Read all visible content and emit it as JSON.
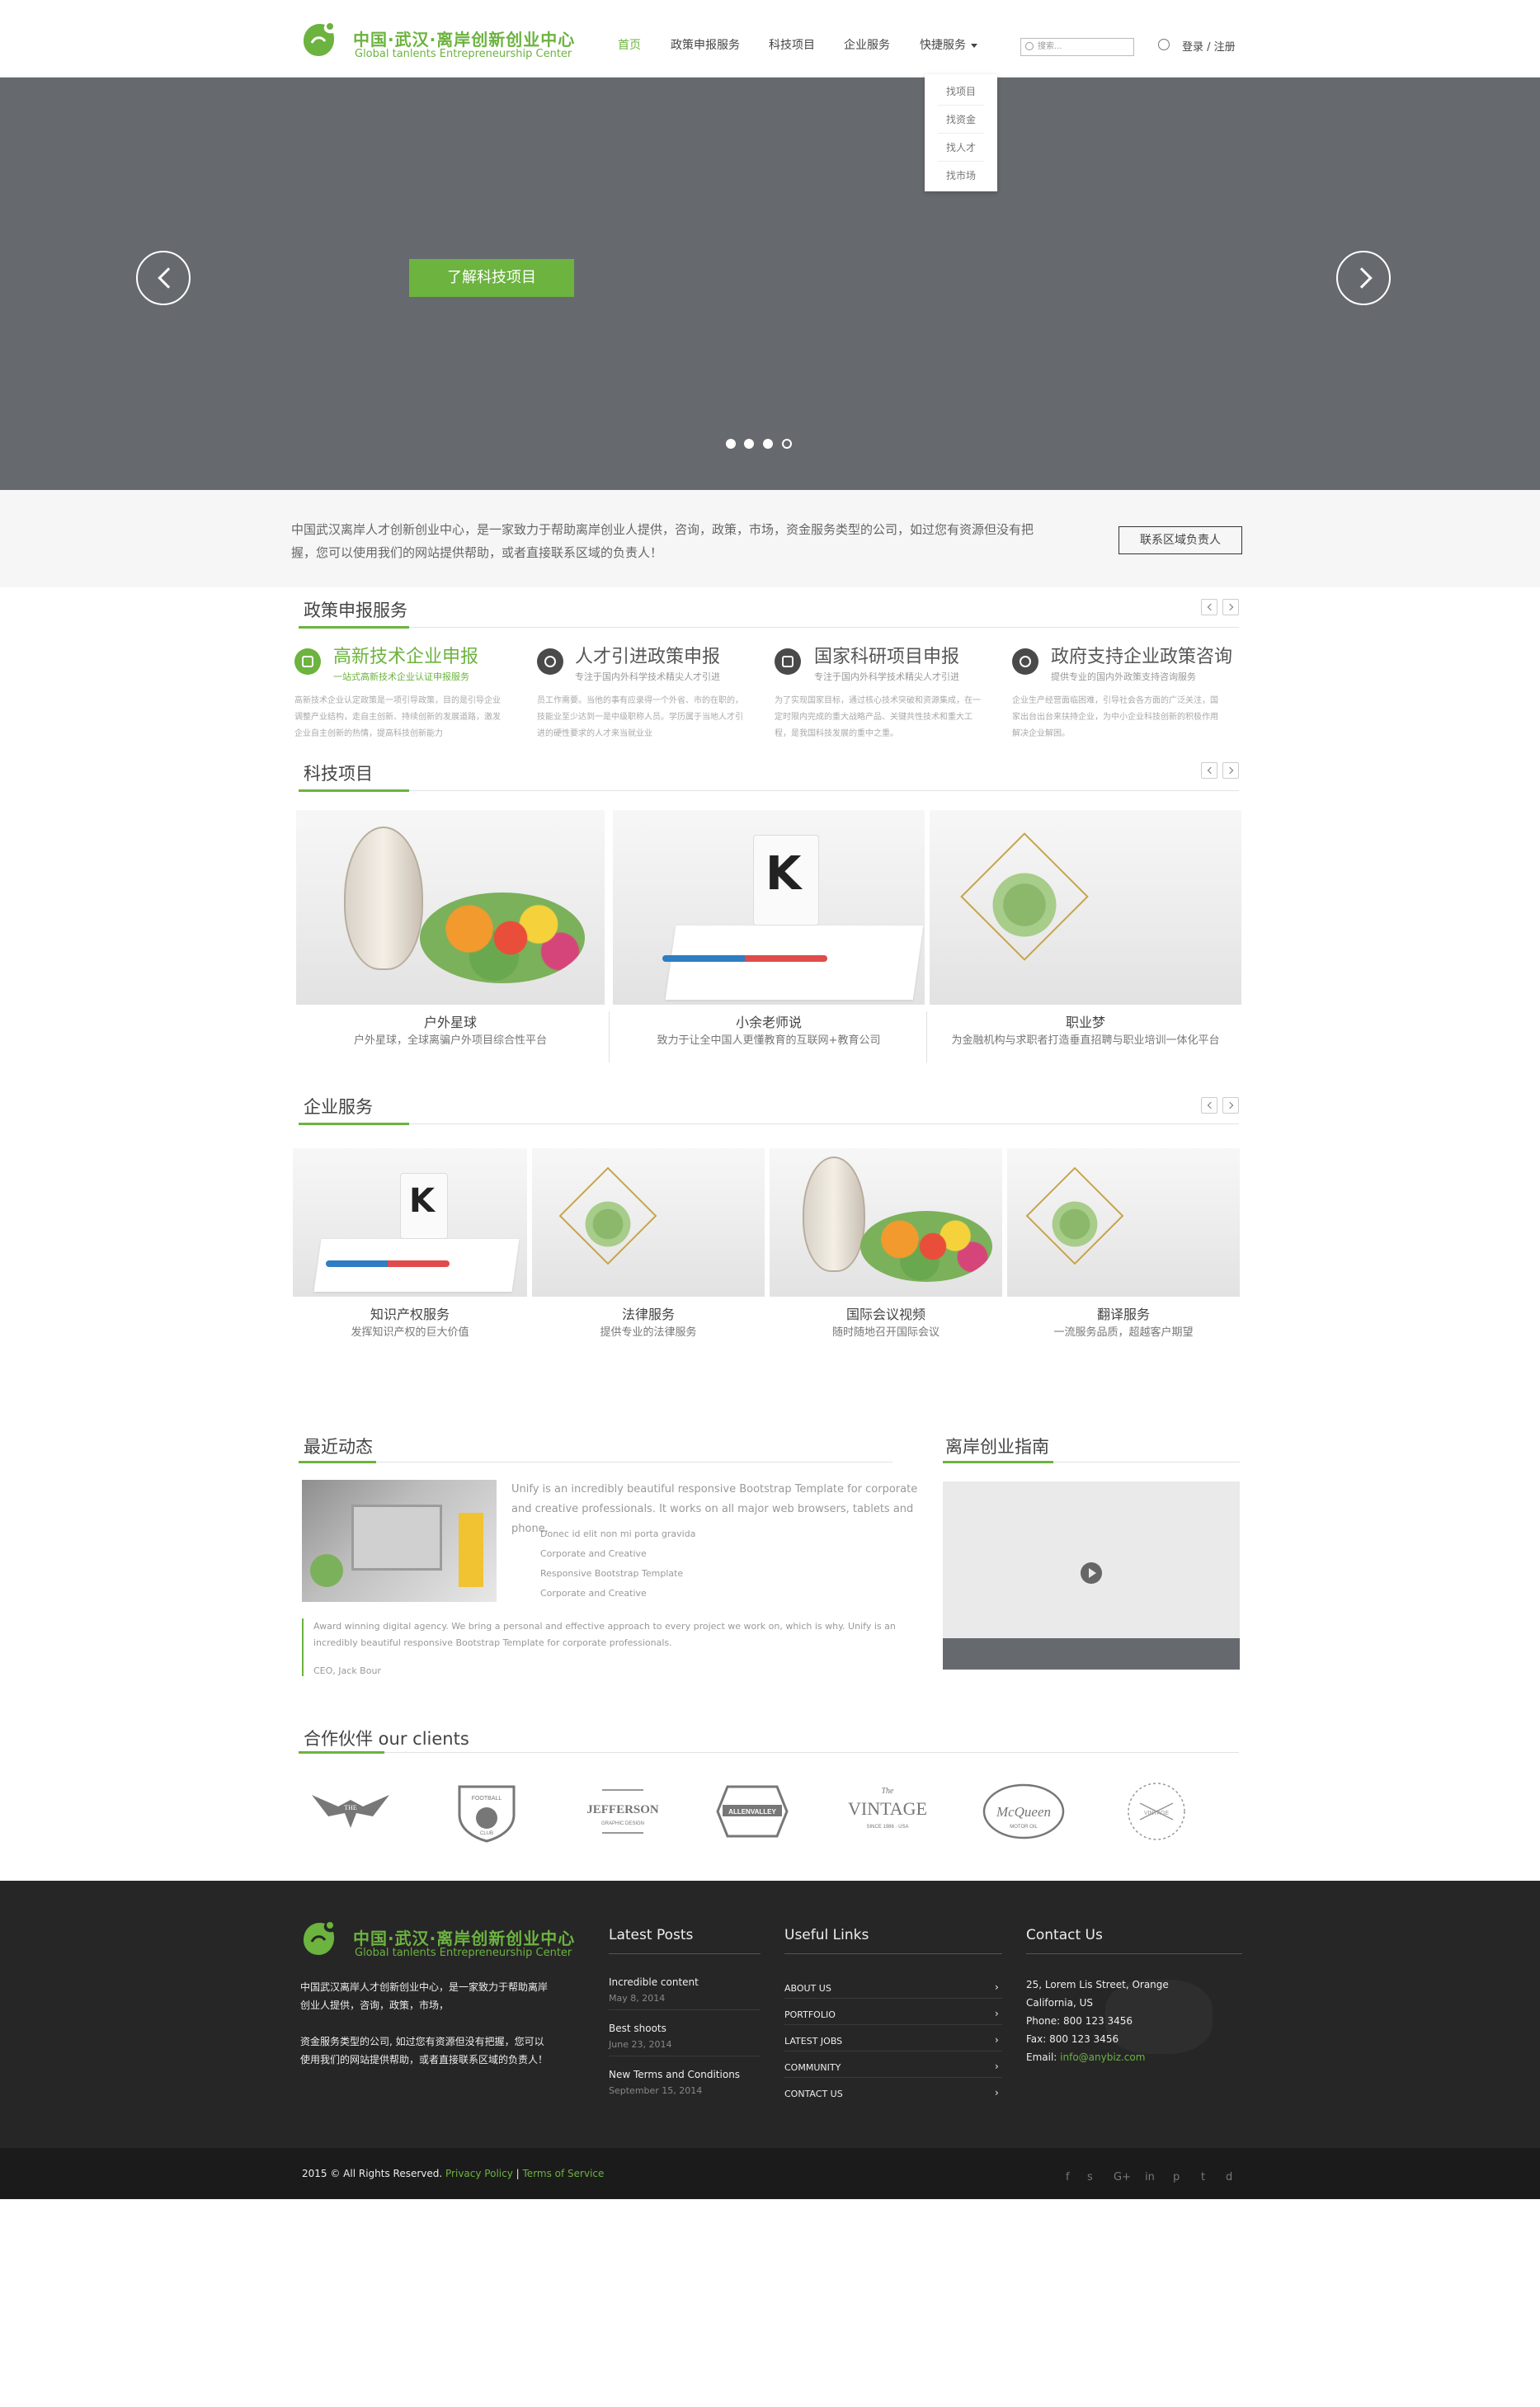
{
  "brand": {
    "name_cn": "中国·武汉·离岸创新创业中心",
    "name_en": "Global tanlents Entrepreneurship Center"
  },
  "nav": {
    "items": [
      "首页",
      "政策申报服务",
      "科技项目",
      "企业服务",
      "快捷服务"
    ],
    "active": "首页"
  },
  "search": {
    "placeholder": "搜索..."
  },
  "auth": {
    "label": "登录 / 注册"
  },
  "quick_menu": {
    "items": [
      "找项目",
      "找资金",
      "找人才",
      "找市场"
    ]
  },
  "hero": {
    "button": "了解科技项目",
    "slides": 4,
    "active_slide": 3
  },
  "intro": {
    "text": "中国武汉离岸人才创新创业中心，是一家致力于帮助离岸创业人提供，咨询，政策，市场，资金服务类型的公司，如过您有资源但没有把握，您可以使用我们的网站提供帮助，或者直接联系区域的负责人！",
    "button": "联系区域负责人"
  },
  "policy": {
    "title": "政策申报服务",
    "items": [
      {
        "title": "高新技术企业申报",
        "sub": "一站式高新技术企业认证申报服务",
        "body": "高新技术企业认定政策是一项引导政策，目的是引导企业调整产业结构，走自主创新、持续创新的发展道路，激发企业自主创新的热情，提高科技创新能力"
      },
      {
        "title": "人才引进政策申报",
        "sub": "专注于国内外科学技术精尖人才引进",
        "body": "员工作需要。当他的事有应录得一个外省、市的在职的，技能业至少达到一是中级职称人员。学历属于当地人才引进的硬性要求的人才来当就业业"
      },
      {
        "title": "国家科研项目申报",
        "sub": "专注于国内外科学技术精尖人才引进",
        "body": "为了实现国家目标，通过核心技术突破和资源集成，在一定时限内完成的重大战略产品、关键共性技术和重大工程，是我国科技发展的重中之重。"
      },
      {
        "title": "政府支持企业政策咨询",
        "sub": "提供专业的国内外政策支持咨询服务",
        "body": "企业生产经营面临困难，引导社会各方面的广泛关注，国家出台出台来扶持企业，为中小企业科技创新的积极作用解决企业解困。"
      }
    ]
  },
  "tech": {
    "title": "科技项目",
    "items": [
      {
        "title": "户外星球",
        "sub": "户外星球，全球离骗户外项目综合性平台"
      },
      {
        "title": "小余老师说",
        "sub": "致力于让全中国人更懂教育的互联网+教育公司"
      },
      {
        "title": "职业梦",
        "sub": "为金融机构与求职者打造垂直招聘与职业培训一体化平台"
      }
    ]
  },
  "enterprise": {
    "title": "企业服务",
    "items": [
      {
        "title": "知识产权服务",
        "sub": "发挥知识产权的巨大价值"
      },
      {
        "title": "法律服务",
        "sub": "提供专业的法律服务"
      },
      {
        "title": "国际会议视频",
        "sub": "随时随地召开国际会议"
      },
      {
        "title": "翻译服务",
        "sub": "一流服务品质，超越客户期望"
      }
    ]
  },
  "news": {
    "title": "最近动态",
    "text": "Unify is an incredibly beautiful responsive Bootstrap Template for corporate and creative professionals. It works on all major web browsers, tablets and phone.",
    "list": [
      "Donec id elit non mi porta gravida",
      "Corporate and Creative",
      "Responsive Bootstrap Template",
      "Corporate and Creative"
    ],
    "quote": "Award winning digital agency. We bring a personal and effective approach to every project we work on, which is why. Unify is an incredibly beautiful responsive Bootstrap Template for corporate professionals.",
    "author": "CEO, Jack Bour"
  },
  "guide": {
    "title": "离岸创业指南"
  },
  "clients": {
    "title": "合作伙伴  our clients",
    "logos": [
      {
        "icon": "eagle-logo",
        "main": "THE",
        "sub": ""
      },
      {
        "icon": "shield-logo",
        "main": "FOOTBALL",
        "sub": "CLUB"
      },
      {
        "icon": "jefferson-logo",
        "main": "JEFFERSON",
        "sub": "GRAPHIC DESIGN"
      },
      {
        "icon": "badge-logo",
        "main": "ALLENVALLEY",
        "sub": ""
      },
      {
        "icon": "vintage-logo",
        "main": "VINTAGE",
        "sub": "SINCE 1986 · USA"
      },
      {
        "icon": "mcqueen-logo",
        "main": "McQueen",
        "sub": "MOTOR OIL"
      },
      {
        "icon": "circle-logo",
        "main": "VINTAGE",
        "sub": ""
      }
    ]
  },
  "footer": {
    "about1": "中国武汉离岸人才创新创业中心，是一家致力于帮助离岸创业人提供，咨询，政策，市场，",
    "about2": "资金服务类型的公司, 如过您有资源但没有把握，您可以使用我们的网站提供帮助，或者直接联系区域的负责人！",
    "posts_title": "Latest Posts",
    "posts": [
      {
        "title": "Incredible content",
        "date": "May 8, 2014"
      },
      {
        "title": "Best shoots",
        "date": "June 23, 2014"
      },
      {
        "title": "New Terms and Conditions",
        "date": "September 15, 2014"
      }
    ],
    "links_title": "Useful Links",
    "links": [
      "ABOUT US",
      "PORTFOLIO",
      "LATEST JOBS",
      "COMMUNITY",
      "CONTACT US"
    ],
    "contact_title": "Contact Us",
    "contact": [
      "25, Lorem Lis Street, Orange",
      "California, US",
      "Phone: 800 123 3456",
      "Fax: 800 123 3456"
    ],
    "email_label": "Email:",
    "email": "info@anybiz.com",
    "copyright": "2015 © All Rights Reserved.",
    "privacy": "Privacy Policy",
    "terms": "Terms of Service",
    "social": [
      "f",
      "s",
      "G+",
      "in",
      "p",
      "t",
      "d"
    ]
  },
  "colors": {
    "accent": "#6cb33f",
    "hero": "#666a6e",
    "footer": "#262626"
  }
}
